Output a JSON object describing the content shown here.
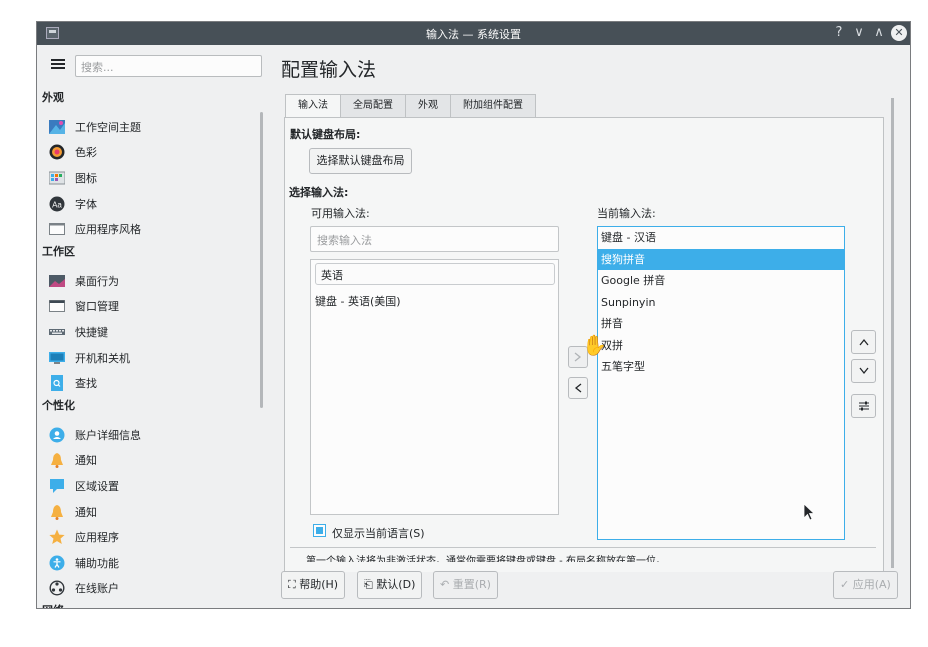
{
  "window": {
    "title": "输入法 — 系统设置",
    "controls": {
      "help": "?",
      "minimize": "∨",
      "maximize": "∧",
      "close": "✕"
    }
  },
  "sidebar": {
    "search_placeholder": "搜索...",
    "categories": [
      {
        "label": "外观",
        "items": [
          {
            "label": "工作空间主题",
            "icon": "workspace-theme-icon"
          },
          {
            "label": "色彩",
            "icon": "colors-icon"
          },
          {
            "label": "图标",
            "icon": "icons-icon"
          },
          {
            "label": "字体",
            "icon": "fonts-icon"
          },
          {
            "label": "应用程序风格",
            "icon": "app-style-icon"
          }
        ]
      },
      {
        "label": "工作区",
        "items": [
          {
            "label": "桌面行为",
            "icon": "desktop-behavior-icon"
          },
          {
            "label": "窗口管理",
            "icon": "window-management-icon"
          },
          {
            "label": "快捷键",
            "icon": "shortcuts-icon"
          },
          {
            "label": "开机和关机",
            "icon": "startup-shutdown-icon"
          },
          {
            "label": "查找",
            "icon": "search-file-icon"
          }
        ]
      },
      {
        "label": "个性化",
        "items": [
          {
            "label": "账户详细信息",
            "icon": "account-icon"
          },
          {
            "label": "通知",
            "icon": "bell-icon"
          },
          {
            "label": "区域设置",
            "icon": "region-icon"
          },
          {
            "label": "通知",
            "icon": "bell-icon"
          },
          {
            "label": "应用程序",
            "icon": "star-icon"
          },
          {
            "label": "辅助功能",
            "icon": "accessibility-icon"
          },
          {
            "label": "在线账户",
            "icon": "online-accounts-icon"
          }
        ]
      },
      {
        "label": "网络",
        "items": []
      }
    ]
  },
  "main": {
    "page_title": "配置输入法",
    "tabs": [
      "输入法",
      "全局配置",
      "外观",
      "附加组件配置"
    ],
    "active_tab": 0,
    "default_layout_label": "默认键盘布局:",
    "select_layout_button": "选择默认键盘布局",
    "select_im_label": "选择输入法:",
    "available_label": "可用输入法:",
    "current_label": "当前输入法:",
    "search_placeholder": "搜索输入法",
    "available_group": "英语",
    "available_items": [
      "键盘 - 英语(美国)"
    ],
    "current_items": [
      "键盘 - 汉语",
      "搜狗拼音",
      "Google 拼音",
      "Sunpinyin",
      "拼音",
      "双拼",
      "五笔字型"
    ],
    "selected_current_index": 1,
    "show_current_language_only": "仅显示当前语言(S)",
    "show_current_language_checked": true,
    "hint": "第一个输入法将为非激活状态。通常你需要将键盘或键盘 - 布局名称放在第一位。"
  },
  "buttons": {
    "help": "帮助(H)",
    "defaults": "默认(D)",
    "reset": "重置(R)",
    "apply": "应用(A)",
    "move_right": ">",
    "move_left": "<",
    "move_up": "^",
    "move_down": "v",
    "configure": "⇌"
  },
  "colors": {
    "accent": "#3daee9",
    "titlebar": "#475057",
    "window_bg": "#eff0f1"
  }
}
